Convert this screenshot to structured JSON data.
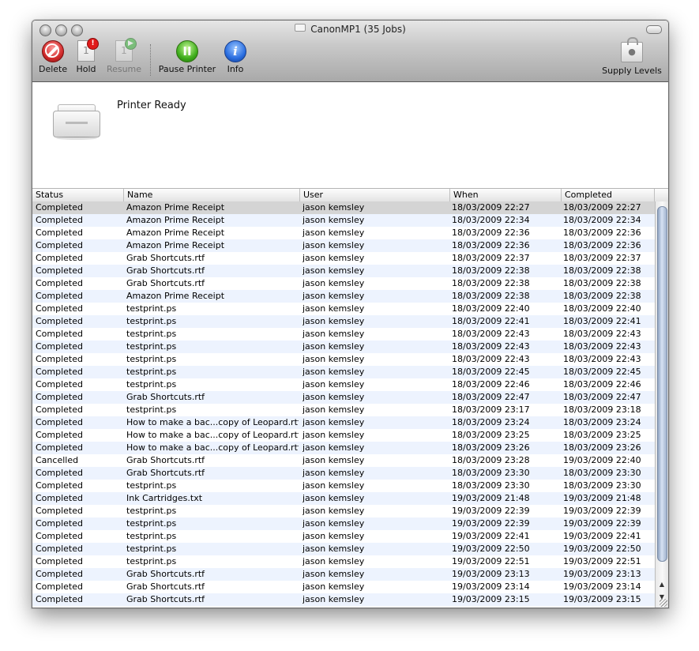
{
  "window": {
    "title": "CanonMP1 (35 Jobs)"
  },
  "toolbar": {
    "delete_label": "Delete",
    "hold_label": "Hold",
    "resume_label": "Resume",
    "pause_label": "Pause Printer",
    "info_label": "Info",
    "supply_label": "Supply Levels",
    "hold_badge": "!",
    "doc_glyph": "1",
    "pause_glyph": "II",
    "info_glyph": "i"
  },
  "status": {
    "text": "Printer Ready"
  },
  "table": {
    "columns": [
      "Status",
      "Name",
      "User",
      "When",
      "Completed"
    ],
    "rows": [
      [
        "Completed",
        "Amazon Prime Receipt",
        "jason kemsley",
        "18/03/2009 22:27",
        "18/03/2009 22:27"
      ],
      [
        "Completed",
        "Amazon Prime Receipt",
        "jason kemsley",
        "18/03/2009 22:34",
        "18/03/2009 22:34"
      ],
      [
        "Completed",
        "Amazon Prime Receipt",
        "jason kemsley",
        "18/03/2009 22:36",
        "18/03/2009 22:36"
      ],
      [
        "Completed",
        "Amazon Prime Receipt",
        "jason kemsley",
        "18/03/2009 22:36",
        "18/03/2009 22:36"
      ],
      [
        "Completed",
        "Grab Shortcuts.rtf",
        "jason kemsley",
        "18/03/2009 22:37",
        "18/03/2009 22:37"
      ],
      [
        "Completed",
        "Grab Shortcuts.rtf",
        "jason kemsley",
        "18/03/2009 22:38",
        "18/03/2009 22:38"
      ],
      [
        "Completed",
        "Grab Shortcuts.rtf",
        "jason kemsley",
        "18/03/2009 22:38",
        "18/03/2009 22:38"
      ],
      [
        "Completed",
        "Amazon Prime Receipt",
        "jason kemsley",
        "18/03/2009 22:38",
        "18/03/2009 22:38"
      ],
      [
        "Completed",
        "testprint.ps",
        "jason kemsley",
        "18/03/2009 22:40",
        "18/03/2009 22:40"
      ],
      [
        "Completed",
        "testprint.ps",
        "jason kemsley",
        "18/03/2009 22:41",
        "18/03/2009 22:41"
      ],
      [
        "Completed",
        "testprint.ps",
        "jason kemsley",
        "18/03/2009 22:43",
        "18/03/2009 22:43"
      ],
      [
        "Completed",
        "testprint.ps",
        "jason kemsley",
        "18/03/2009 22:43",
        "18/03/2009 22:43"
      ],
      [
        "Completed",
        "testprint.ps",
        "jason kemsley",
        "18/03/2009 22:43",
        "18/03/2009 22:43"
      ],
      [
        "Completed",
        "testprint.ps",
        "jason kemsley",
        "18/03/2009 22:45",
        "18/03/2009 22:45"
      ],
      [
        "Completed",
        "testprint.ps",
        "jason kemsley",
        "18/03/2009 22:46",
        "18/03/2009 22:46"
      ],
      [
        "Completed",
        "Grab Shortcuts.rtf",
        "jason kemsley",
        "18/03/2009 22:47",
        "18/03/2009 22:47"
      ],
      [
        "Completed",
        "testprint.ps",
        "jason kemsley",
        "18/03/2009 23:17",
        "18/03/2009 23:18"
      ],
      [
        "Completed",
        "How to make a bac...copy of Leopard.rtf",
        "jason kemsley",
        "18/03/2009 23:24",
        "18/03/2009 23:24"
      ],
      [
        "Completed",
        "How to make a bac...copy of Leopard.rtf",
        "jason kemsley",
        "18/03/2009 23:25",
        "18/03/2009 23:25"
      ],
      [
        "Completed",
        "How to make a bac...copy of Leopard.rtf",
        "jason kemsley",
        "18/03/2009 23:26",
        "18/03/2009 23:26"
      ],
      [
        "Cancelled",
        "Grab Shortcuts.rtf",
        "jason kemsley",
        "18/03/2009 23:28",
        "19/03/2009 22:40"
      ],
      [
        "Completed",
        "Grab Shortcuts.rtf",
        "jason kemsley",
        "18/03/2009 23:30",
        "18/03/2009 23:30"
      ],
      [
        "Completed",
        "testprint.ps",
        "jason kemsley",
        "18/03/2009 23:30",
        "18/03/2009 23:30"
      ],
      [
        "Completed",
        "Ink Cartridges.txt",
        "jason kemsley",
        "19/03/2009 21:48",
        "19/03/2009 21:48"
      ],
      [
        "Completed",
        "testprint.ps",
        "jason kemsley",
        "19/03/2009 22:39",
        "19/03/2009 22:39"
      ],
      [
        "Completed",
        "testprint.ps",
        "jason kemsley",
        "19/03/2009 22:39",
        "19/03/2009 22:39"
      ],
      [
        "Completed",
        "testprint.ps",
        "jason kemsley",
        "19/03/2009 22:41",
        "19/03/2009 22:41"
      ],
      [
        "Completed",
        "testprint.ps",
        "jason kemsley",
        "19/03/2009 22:50",
        "19/03/2009 22:50"
      ],
      [
        "Completed",
        "testprint.ps",
        "jason kemsley",
        "19/03/2009 22:51",
        "19/03/2009 22:51"
      ],
      [
        "Completed",
        "Grab Shortcuts.rtf",
        "jason kemsley",
        "19/03/2009 23:13",
        "19/03/2009 23:13"
      ],
      [
        "Completed",
        "Grab Shortcuts.rtf",
        "jason kemsley",
        "19/03/2009 23:14",
        "19/03/2009 23:14"
      ],
      [
        "Completed",
        "Grab Shortcuts.rtf",
        "jason kemsley",
        "19/03/2009 23:15",
        "19/03/2009 23:15"
      ]
    ],
    "selected_row": 0
  },
  "scrollbar": {
    "up_glyph": "▲",
    "down_glyph": "▼"
  },
  "colors": {
    "stripe": "#edf3fe",
    "selected": "#d4d4d4"
  }
}
